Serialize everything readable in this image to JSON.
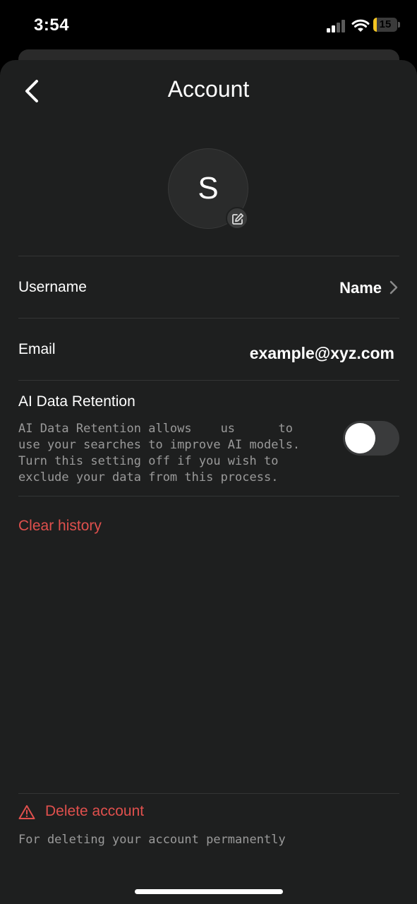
{
  "status_bar": {
    "time": "3:54",
    "battery_level": "15",
    "battery_fraction": 0.15,
    "battery_color": "#f3c522"
  },
  "header": {
    "title": "Account",
    "back_icon": "chevron-left-icon"
  },
  "profile": {
    "avatar_letter": "S",
    "edit_icon": "edit-icon"
  },
  "username": {
    "label": "Username",
    "value": "Name",
    "icon": "chevron-right-icon"
  },
  "email": {
    "label": "Email",
    "value": "example@xyz.com"
  },
  "ai_retention": {
    "label": "AI Data Retention",
    "description": "AI Data Retention allows    us      to\nuse your searches to improve AI models.\nTurn this setting off if you wish to\nexclude your data from this process.",
    "enabled": false
  },
  "clear_history": {
    "label": "Clear history",
    "color": "#e0504d"
  },
  "delete_account": {
    "label": "Delete account",
    "description": "For deleting your account permanently",
    "icon": "warning-icon",
    "color": "#e0504d"
  }
}
